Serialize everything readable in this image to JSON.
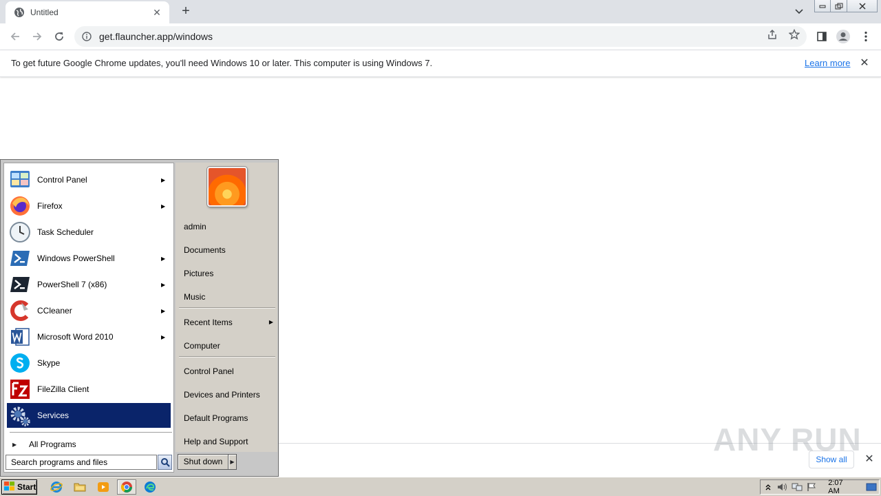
{
  "browser": {
    "tab_title": "Untitled",
    "tab_close": "✕",
    "new_tab": "+",
    "url": "get.flauncher.app/windows"
  },
  "infobar": {
    "message": "To get future Google Chrome updates, you'll need Windows 10 or later. This computer is using Windows 7.",
    "learn_more": "Learn more",
    "close": "✕"
  },
  "download_shelf": {
    "show_all": "Show all",
    "close": "✕",
    "watermark": "ANY RUN"
  },
  "start_menu": {
    "programs": [
      {
        "label": "Control Panel",
        "icon": "control-panel-icon",
        "submenu": true
      },
      {
        "label": "Firefox",
        "icon": "firefox-icon",
        "submenu": true
      },
      {
        "label": "Task Scheduler",
        "icon": "clock-icon",
        "submenu": false
      },
      {
        "label": "Windows PowerShell",
        "icon": "powershell-icon",
        "submenu": true
      },
      {
        "label": "PowerShell 7 (x86)",
        "icon": "powershell7-icon",
        "submenu": true
      },
      {
        "label": "CCleaner",
        "icon": "ccleaner-icon",
        "submenu": true
      },
      {
        "label": "Microsoft Word 2010",
        "icon": "word-icon",
        "submenu": true
      },
      {
        "label": "Skype",
        "icon": "skype-icon",
        "submenu": false
      },
      {
        "label": "FileZilla Client",
        "icon": "filezilla-icon",
        "submenu": false
      },
      {
        "label": "Services",
        "icon": "gear-icon",
        "submenu": false,
        "selected": true
      }
    ],
    "all_programs": "All Programs",
    "search_placeholder": "Search programs and files",
    "right": {
      "user": "admin",
      "documents": "Documents",
      "pictures": "Pictures",
      "music": "Music",
      "recent_items": "Recent Items",
      "computer": "Computer",
      "control_panel": "Control Panel",
      "devices_printers": "Devices and Printers",
      "default_programs": "Default Programs",
      "help_support": "Help and Support"
    },
    "shutdown": "Shut down"
  },
  "taskbar": {
    "start": "Start",
    "clock": "2:07 AM"
  },
  "colors": {
    "selection": "#0a246a",
    "accent_link": "#1a73e8",
    "classic_gray": "#d4d0c8"
  }
}
